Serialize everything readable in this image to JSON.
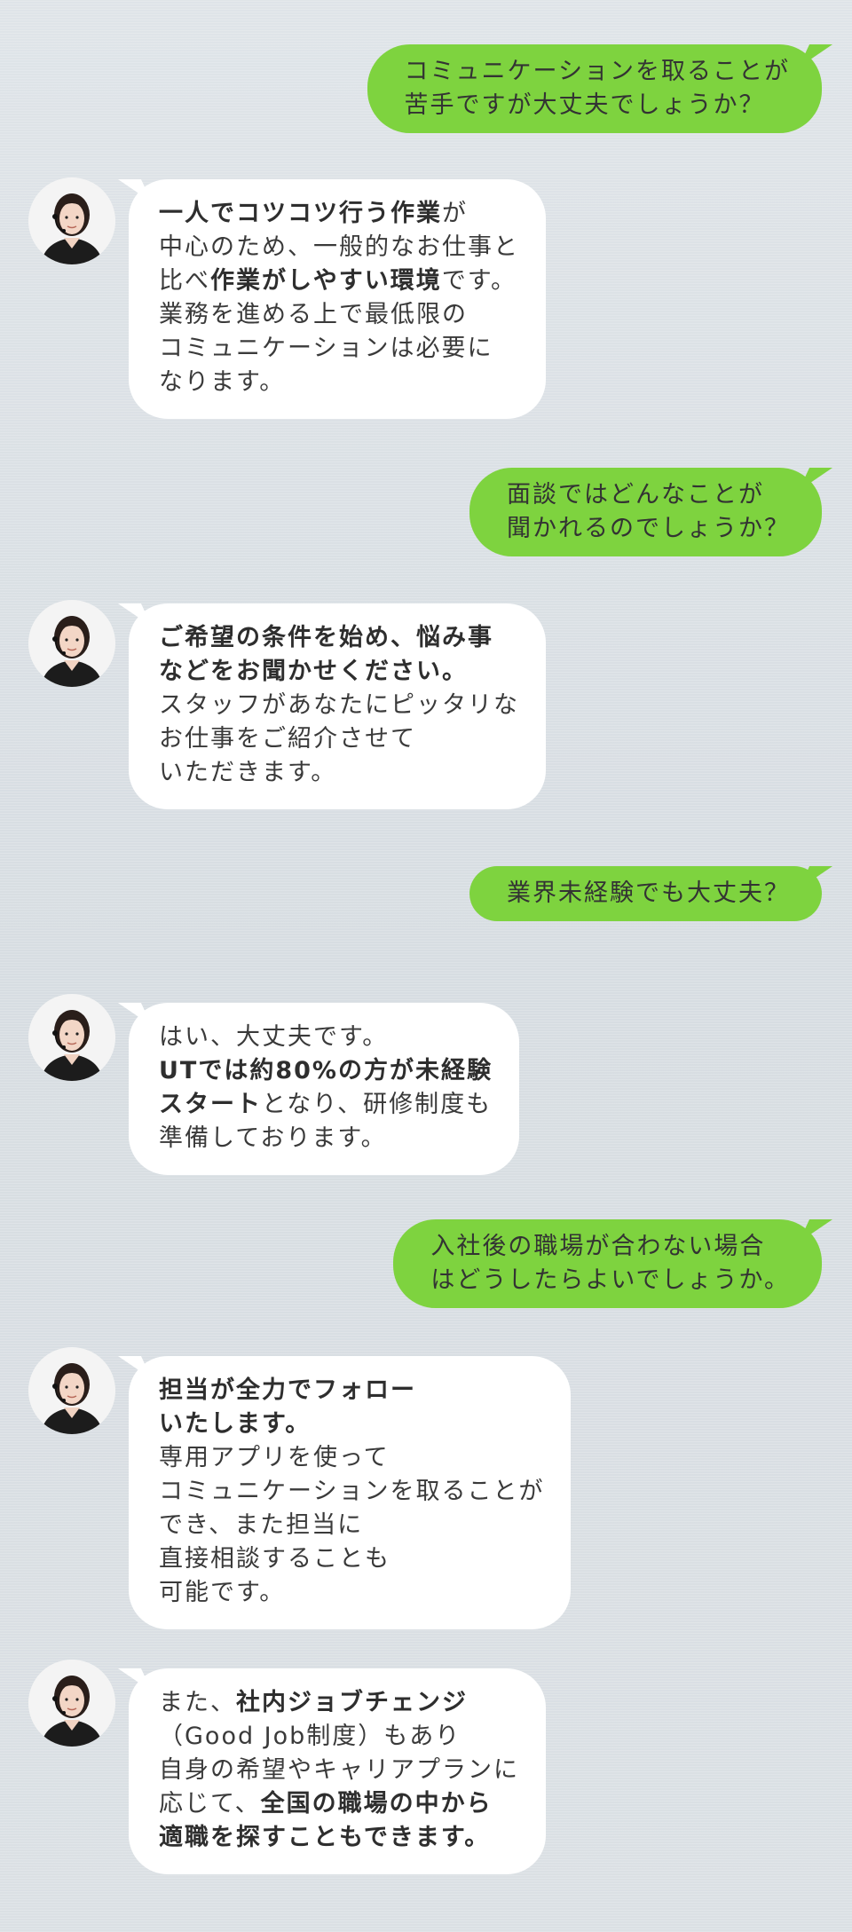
{
  "messages": [
    {
      "role": "user",
      "lines": [
        "コミュニケーションを取ることが",
        "苦手ですが大丈夫でしょうか？"
      ]
    },
    {
      "role": "staff",
      "lines": [
        {
          "b": "一人でコツコツ行う作業",
          "t": "が"
        },
        {
          "t": "中心のため、一般的なお仕事と"
        },
        {
          "t1": "比べ",
          "b": "作業がしやすい環境",
          "t": "です。"
        },
        {
          "t": "業務を進める上で最低限の"
        },
        {
          "t": "コミュニケーションは必要に"
        },
        {
          "t": "なります。"
        }
      ]
    },
    {
      "role": "user",
      "lines": [
        "面談ではどんなことが",
        "聞かれるのでしょうか？"
      ]
    },
    {
      "role": "staff",
      "lines": [
        {
          "b": "ご希望の条件を始め、悩み事"
        },
        {
          "b": "などをお聞かせください。"
        },
        {
          "t": "スタッフがあなたにピッタリな"
        },
        {
          "t": "お仕事をご紹介させて"
        },
        {
          "t": "いただきます。"
        }
      ]
    },
    {
      "role": "user",
      "lines": [
        "業界未経験でも大丈夫？"
      ]
    },
    {
      "role": "staff",
      "lines": [
        {
          "t": "はい、大丈夫です。"
        },
        {
          "b": "UTでは約80%の方が未経験"
        },
        {
          "b": "スタート",
          "t": "となり、研修制度も"
        },
        {
          "t": "準備しております。"
        }
      ]
    },
    {
      "role": "user",
      "lines": [
        "入社後の職場が合わない場合",
        "はどうしたらよいでしょうか。"
      ]
    },
    {
      "role": "staff",
      "lines": [
        {
          "b": "担当が全力でフォロー"
        },
        {
          "b": "いたします。"
        },
        {
          "t": "専用アプリを使って"
        },
        {
          "t": "コミュニケーションを取ることが"
        },
        {
          "t": "でき、また担当に"
        },
        {
          "t": "直接相談することも"
        },
        {
          "t": "可能です。"
        }
      ]
    },
    {
      "role": "staff",
      "lines": [
        {
          "t1": "また、",
          "b": "社内ジョブチェンジ"
        },
        {
          "t": "（Good Job制度）もあり"
        },
        {
          "t": "自身の希望やキャリアプランに"
        },
        {
          "t1": "応じて、",
          "b": "全国の職場の中から"
        },
        {
          "b": "適職を探すこともできます。"
        }
      ]
    }
  ]
}
